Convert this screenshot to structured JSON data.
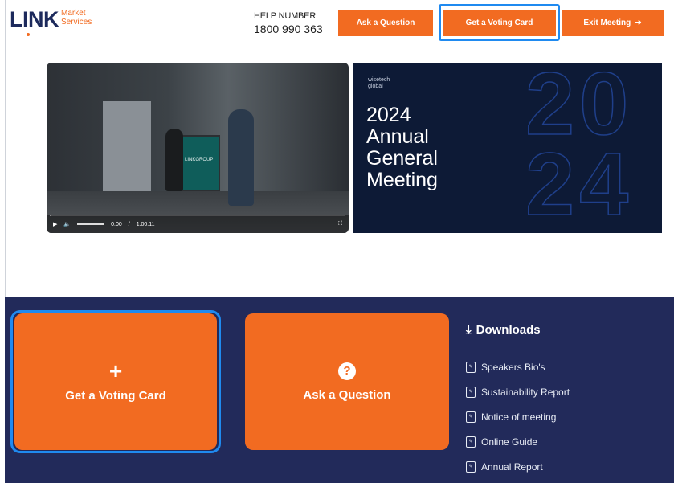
{
  "header": {
    "logo_main": "LINK",
    "logo_sub_line1": "Market",
    "logo_sub_line2": "Services",
    "help_label": "HELP NUMBER",
    "help_number": "1800 990 363",
    "buttons": {
      "ask_question": "Ask a Question",
      "get_voting_card": "Get a Voting Card",
      "exit_meeting": "Exit Meeting"
    }
  },
  "video": {
    "time_current": "0:00",
    "time_total": "1:00:11",
    "screen_text": "LINKGROUP",
    "progress_fraction": 0.005
  },
  "banner": {
    "brand_line1": "wisetech",
    "brand_line2": "global",
    "title_line1": "2024",
    "title_line2": "Annual",
    "title_line3": "General",
    "title_line4": "Meeting",
    "big_digits_top": "20",
    "big_digits_bottom": "24"
  },
  "tiles": {
    "vote_label": "Get a Voting Card",
    "ask_label": "Ask a Question"
  },
  "downloads": {
    "title": "Downloads",
    "items": [
      {
        "label": "Speakers Bio's"
      },
      {
        "label": "Sustainability Report"
      },
      {
        "label": "Notice of meeting"
      },
      {
        "label": "Online Guide"
      },
      {
        "label": "Annual Report"
      }
    ]
  },
  "colors": {
    "accent_orange": "#f26b21",
    "navy_panel": "#222a5a",
    "highlight_blue": "#1f8af0"
  }
}
